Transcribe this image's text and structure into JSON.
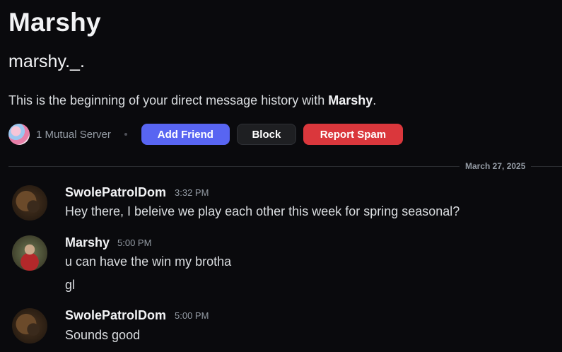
{
  "profile": {
    "display_name": "Marshy",
    "username": "marshy._.",
    "intro_prefix": "This is the beginning of your direct message history with ",
    "intro_name": "Marshy",
    "intro_suffix": ".",
    "mutual_servers": "1 Mutual Server"
  },
  "buttons": {
    "add_friend": "Add Friend",
    "block": "Block",
    "report_spam": "Report Spam"
  },
  "date_divider": "March 27, 2025",
  "messages": [
    {
      "author": "SwolePatrolDom",
      "time": "3:32 PM",
      "lines": [
        "Hey there, I beleive we play each other this week for spring seasonal?"
      ]
    },
    {
      "author": "Marshy",
      "time": "5:00 PM",
      "lines": [
        "u can have the win my brotha",
        "gl"
      ]
    },
    {
      "author": "SwolePatrolDom",
      "time": "5:00 PM",
      "lines": [
        "Sounds good"
      ]
    }
  ],
  "colors": {
    "background": "#0a0a0d",
    "add_friend": "#5865f2",
    "report_spam": "#da373c"
  }
}
